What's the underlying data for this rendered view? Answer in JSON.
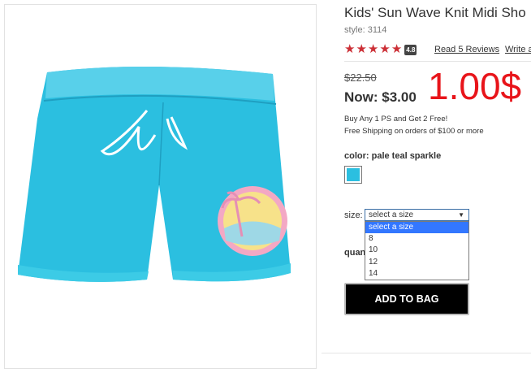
{
  "product": {
    "title": "Kids' Sun Wave Knit Midi Sho",
    "style": "style: 3114",
    "rating": {
      "stars": 5,
      "badge": "4.8"
    },
    "reviews_link": "Read 5 Reviews",
    "write_link": "Write a",
    "was_price": "$22.50",
    "now_price": "Now: $3.00",
    "overlay_price": "1.00$",
    "promo_line1": "Buy Any 1 PS and Get 2 Free!",
    "promo_line2": "Free Shipping on orders of $100 or more",
    "color_label": "color: pale teal sparkle",
    "swatch_color": "#2bbfe0"
  },
  "size": {
    "label": "size:",
    "selected": "select a size",
    "options": [
      "select a size",
      "8",
      "10",
      "12",
      "14"
    ]
  },
  "quantity_label": "quantity",
  "add_to_bag_label": "ADD TO BAG",
  "colors": {
    "star": "#cc2f36",
    "overlay_price": "#e8141a",
    "highlight": "#3377ff",
    "shorts": "#2bbfe0"
  }
}
